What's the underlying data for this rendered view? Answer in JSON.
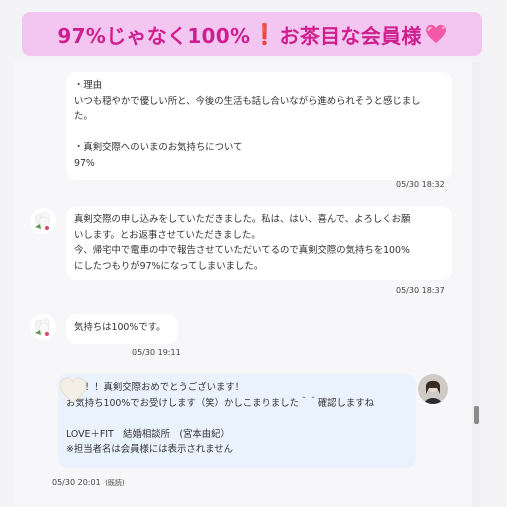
{
  "title": {
    "text_before": "97%じゃなく100%",
    "exclamation": "❗",
    "text_after": "お茶目な会員様",
    "heart": "heart-icon"
  },
  "messages": [
    {
      "side": "member",
      "lines": [
        "・理由",
        "いつも穏やかで優しい所と、今後の生活も話し合いながら進められそうと感じまし",
        "た。",
        "",
        "・真剣交際へのいまのお気持ちについて",
        "97%"
      ],
      "timestamp": "05/30 18:32"
    },
    {
      "side": "member",
      "avatar": "flower-avatar-icon",
      "lines": [
        "真剣交際の申し込みをしていただきました。私は、はい、喜んで、よろしくお願",
        "いします。とお返事させていただきました。",
        "今、帰宅中で電車の中で報告させていただいてるので真剣交際の気持ちを100%",
        "にしたつもりが97%になってしまいました。"
      ],
      "timestamp": "05/30 18:37"
    },
    {
      "side": "member",
      "avatar": "flower-avatar-icon",
      "lines": [
        "気持ちは100%です。"
      ],
      "timestamp": "05/30 19:11"
    },
    {
      "side": "counselor",
      "avatar": "counselor-photo-icon",
      "lines": [
        "さん！！真剣交際おめでとうございます！",
        "お気持ち100%でお受けします（笑）かしこまりました＾＾確認しますね",
        "",
        "LOVE＋FIT　結婚相談所　(宮本由紀）",
        "※担当者名は会員様には表示されません"
      ],
      "timestamp": "05/30 20:01",
      "read_status": "(既読)"
    }
  ],
  "colors": {
    "banner_bg": "#f2c6f0",
    "banner_text": "#cf1f8e",
    "counselor_bubble": "#eaf3fd",
    "member_bubble": "#ffffff"
  }
}
